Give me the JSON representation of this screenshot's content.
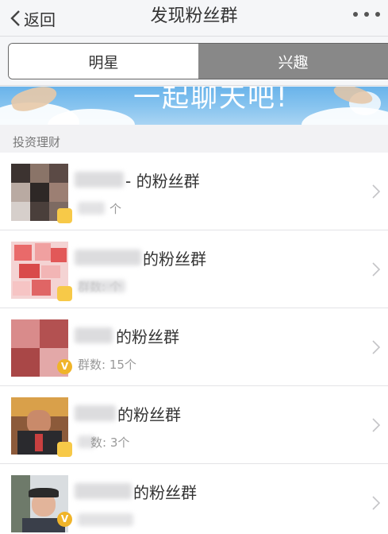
{
  "nav": {
    "back_label": "返回",
    "title": "发现粉丝群"
  },
  "tabs": [
    {
      "label": "明星"
    },
    {
      "label": "兴趣"
    }
  ],
  "banner": {
    "text": "一起聊天吧!"
  },
  "section": {
    "label": "投资理财"
  },
  "groups": [
    {
      "name_suffix": "- 的粉丝群",
      "count": "个",
      "badge": ""
    },
    {
      "name_suffix": "的粉丝群",
      "count": "群数: 个",
      "badge": ""
    },
    {
      "name_suffix": "的粉丝群",
      "count": "群数: 15个",
      "badge": "V"
    },
    {
      "name_suffix": "的粉丝群",
      "count": "数: 3个",
      "badge": ""
    },
    {
      "name_suffix": "的粉丝群",
      "count": "",
      "badge": "V"
    }
  ]
}
